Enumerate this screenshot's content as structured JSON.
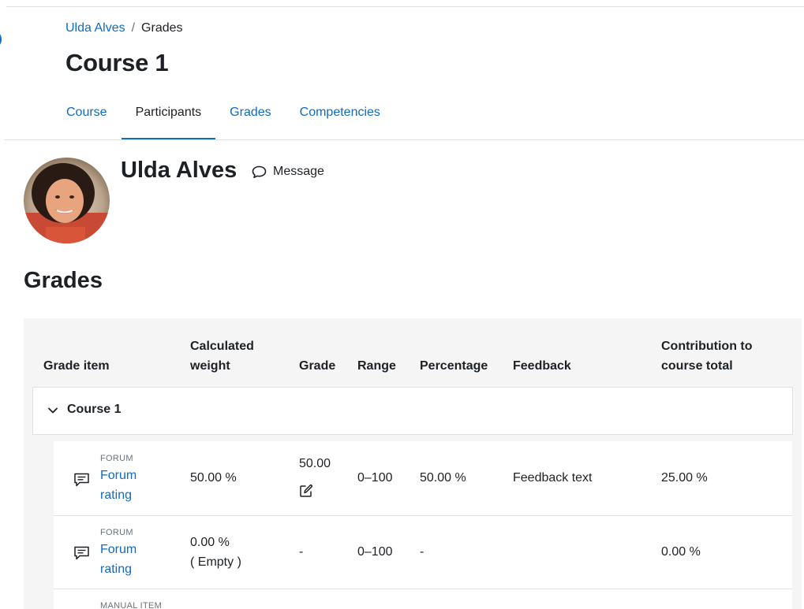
{
  "breadcrumb": {
    "user": "Ulda Alves",
    "separator": "/",
    "current": "Grades"
  },
  "page_title": "Course 1",
  "tabs": [
    {
      "label": "Course"
    },
    {
      "label": "Participants"
    },
    {
      "label": "Grades"
    },
    {
      "label": "Competencies"
    }
  ],
  "active_tab": "Participants",
  "user": {
    "name": "Ulda Alves",
    "message_label": "Message"
  },
  "section_title": "Grades",
  "table": {
    "headers": {
      "grade_item": "Grade item",
      "calculated_weight_1": "Calculated",
      "calculated_weight_2": "weight",
      "grade": "Grade",
      "range": "Range",
      "percentage": "Percentage",
      "feedback": "Feedback",
      "contribution_1": "Contribution to",
      "contribution_2": "course total"
    },
    "category": {
      "name": "Course 1"
    },
    "rows": [
      {
        "module": "FORUM",
        "name_line1": "Forum",
        "name_line2": "rating",
        "weight": "50.00 %",
        "weight_note": "",
        "grade": "50.00",
        "range": "0–100",
        "percentage": "50.00 %",
        "feedback": "Feedback text",
        "contribution": "25.00 %"
      },
      {
        "module": "FORUM",
        "name_line1": "Forum",
        "name_line2": "rating",
        "weight": "0.00 %",
        "weight_note": "( Empty )",
        "grade": "-",
        "range": "0–100",
        "percentage": "-",
        "feedback": "",
        "contribution": "0.00 %"
      },
      {
        "module": "MANUAL ITEM"
      }
    ]
  },
  "colors": {
    "link": "#0f6cbf",
    "text": "#1d2125",
    "muted": "#6a737b",
    "panel": "#f5f5f5",
    "border": "#dee2e6"
  }
}
